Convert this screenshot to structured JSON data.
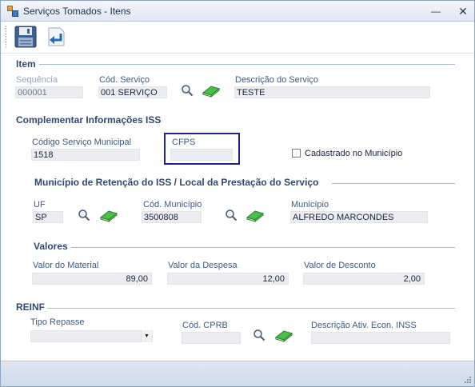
{
  "window": {
    "title": "Serviços Tomados - Itens",
    "minimize": "—",
    "close": "✕"
  },
  "toolbar": {
    "save_icon": "floppy-disk-icon",
    "back_icon": "return-arrow-icon"
  },
  "item": {
    "section": "Item",
    "seq_label": "Sequência",
    "seq_value": "000001",
    "cod_label": "Cód. Serviço",
    "cod_value": "001 SERVIÇO",
    "desc_label": "Descrição do Serviço",
    "desc_value": "TESTE"
  },
  "complementar": {
    "section": "Complementar Informações ISS",
    "cod_mun_label": "Código Serviço Municipal",
    "cod_mun_value": "1518",
    "cfps_label": "CFPS",
    "cfps_value": "",
    "cadastrado_label": "Cadastrado no Município",
    "cadastrado_checked": false
  },
  "municipio": {
    "section": "Município de Retenção do ISS / Local da Prestação  do Serviço",
    "uf_label": "UF",
    "uf_value": "SP",
    "cod_mun_label": "Cód. Município",
    "cod_mun_value": "3500808",
    "mun_label": "Município",
    "mun_value": "ALFREDO MARCONDES"
  },
  "valores": {
    "section": "Valores",
    "material_label": "Valor do Material",
    "material_value": "89,00",
    "despesa_label": "Valor da Despesa",
    "despesa_value": "12,00",
    "desconto_label": "Valor de Desconto",
    "desconto_value": "2,00"
  },
  "reinf": {
    "section": "REINF",
    "tipo_label": "Tipo Repasse",
    "tipo_value": "",
    "cprb_label": "Cód. CPRB",
    "cprb_value": "",
    "desc_label": "Descrição Ativ. Econ. INSS",
    "desc_value": ""
  },
  "icons": {
    "search": "magnifier-icon",
    "clear": "eraser-icon"
  }
}
